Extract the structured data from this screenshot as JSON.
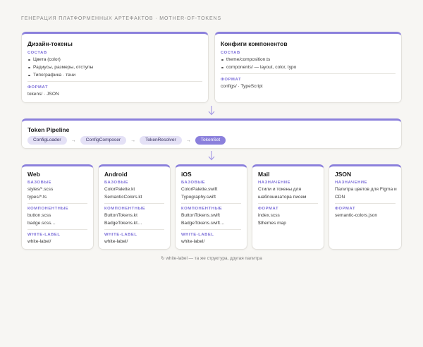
{
  "page": {
    "title": "ГЕНЕРАЦИЯ ПЛАТФОРМЕННЫХ АРТЕФАКТОВ · MOTHER-OF-TOKENS"
  },
  "sources": [
    {
      "title": "Дизайн-токены",
      "sections": [
        {
          "label": "СОСТАВ",
          "bullets": [
            "Цвета (color)",
            "Радиусы, размеры, отступы",
            "Типографика · тени"
          ]
        },
        {
          "label": "ФОРМАТ",
          "lines": [
            "tokens/ · JSON"
          ]
        }
      ]
    },
    {
      "title": "Конфиги компонентов",
      "sections": [
        {
          "label": "СОСТАВ",
          "bullets": [
            "theme/composition.ts",
            "components/ — layout, color, typo"
          ]
        },
        {
          "label": "ФОРМАТ",
          "lines": [
            "configs/ · TypeScript"
          ]
        }
      ]
    }
  ],
  "pipeline": {
    "title": "Token Pipeline",
    "steps": [
      "ConfigLoader",
      "ConfigComposer",
      "TokenResolver",
      "TokenSet"
    ],
    "arrow": "→"
  },
  "platforms": [
    {
      "title": "Web",
      "sections": [
        {
          "label": "БАЗОВЫЕ",
          "lines": [
            "styles/*.scss",
            "types/*.ts"
          ]
        },
        {
          "label": "КОМПОНЕНТНЫЕ",
          "lines": [
            "button.scss",
            "badge.scss…"
          ]
        },
        {
          "label": "WHITE-LABEL",
          "lines": [
            "white-label/"
          ]
        }
      ]
    },
    {
      "title": "Android",
      "sections": [
        {
          "label": "БАЗОВЫЕ",
          "lines": [
            "ColorPalette.kt",
            "SemanticColors.kt"
          ]
        },
        {
          "label": "КОМПОНЕНТНЫЕ",
          "lines": [
            "ButtonTokens.kt",
            "BadgeTokens.kt…"
          ]
        },
        {
          "label": "WHITE-LABEL",
          "lines": [
            "white-label/"
          ]
        }
      ]
    },
    {
      "title": "iOS",
      "sections": [
        {
          "label": "БАЗОВЫЕ",
          "lines": [
            "ColorPalette.swift",
            "Typography.swift"
          ]
        },
        {
          "label": "КОМПОНЕНТНЫЕ",
          "lines": [
            "ButtonTokens.swift",
            "BadgeTokens.swift…"
          ]
        },
        {
          "label": "WHITE-LABEL",
          "lines": [
            "white-label/"
          ]
        }
      ]
    },
    {
      "title": "Mail",
      "sections": [
        {
          "label": "НАЗНАЧЕНИЕ",
          "lines": [
            "Стили и токены для",
            "шаблонизатора писем"
          ]
        },
        {
          "label": "ФОРМАТ",
          "lines": [
            "index.scss",
            "$themes map"
          ]
        }
      ]
    },
    {
      "title": "JSON",
      "sections": [
        {
          "label": "НАЗНАЧЕНИЕ",
          "lines": [
            "Палитра цветов для Figma и",
            "CDN"
          ]
        },
        {
          "label": "ФОРМАТ",
          "lines": [
            "semantic-colors.json"
          ]
        }
      ]
    }
  ],
  "footer": {
    "note": "↻ white-label — та же структура, другая палитра"
  },
  "colors": {
    "accent": "#8b80dc",
    "label": "#7c6fd8",
    "pill": "#e4e1f6",
    "background": "#f7f6f3"
  },
  "icons": {
    "flow_arrow": "arrow-down-icon"
  }
}
